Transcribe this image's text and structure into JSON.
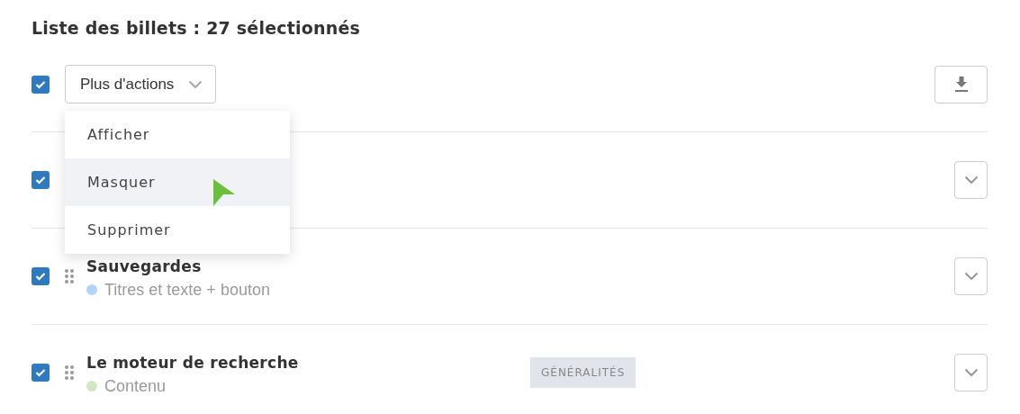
{
  "heading": "Liste des billets : 27 sélectionnés",
  "toolbar": {
    "select_all": {
      "checked": true
    },
    "actions_button": "Plus d'actions",
    "menu": {
      "items": [
        {
          "label": "Afficher",
          "selected": false
        },
        {
          "label": "Masquer",
          "selected": true
        },
        {
          "label": "Supprimer",
          "selected": false
        }
      ]
    }
  },
  "rows": [
    {
      "checked": true
    },
    {
      "checked": true,
      "title": "Sauvegardes",
      "subtitle": "Titres et texte + bouton",
      "color": "#b3d4f5"
    },
    {
      "checked": true,
      "title": "Le moteur de recherche",
      "subtitle": "Contenu",
      "color": "#d2e6c6",
      "tag": "GÉNÉRALITÉS"
    }
  ]
}
